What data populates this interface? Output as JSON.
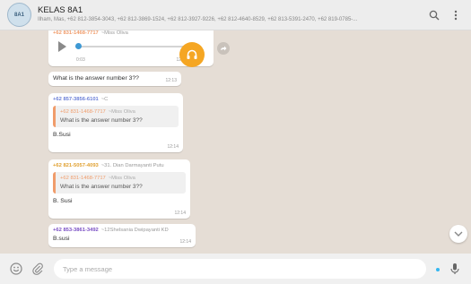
{
  "header": {
    "avatar_text": "8A1",
    "title": "KELAS 8A1",
    "subtitle": "Ilham, Mas, +62 812-3854-3043, +62 812-3869-1524, +62 812-3927-9226, +62 812-4640-8529, +62 813-5391-2470, +62 819-0785-..."
  },
  "messages": [
    {
      "type": "audio",
      "sender": "+62 831-1468-7717",
      "alias": "~Miss Oliva",
      "elapsed": "0:03",
      "time": "12:13"
    },
    {
      "type": "text",
      "text": "What is the answer number 3??",
      "time": "12:13"
    },
    {
      "type": "reply",
      "sender": "+62 857-3856-6101",
      "alias": "~C",
      "quote_sender": "+62 831-1468-7717",
      "quote_alias": "~Miss Oliva",
      "quote_text": "What is the answer number 3??",
      "text": "B.Susi",
      "time": "12:14"
    },
    {
      "type": "reply",
      "sender": "+62 821-5057-4093",
      "alias": "~31. Dian Darmayanti Putu",
      "quote_sender": "+62 831-1468-7717",
      "quote_alias": "~Miss Oliva",
      "quote_text": "What is the answer number 3??",
      "text": "B. Susi",
      "time": "12:14"
    },
    {
      "type": "text_sender",
      "sender": "+62 853-3861-3492",
      "alias": "~12Shelsania Dwipayanti KD",
      "text": "B.susi",
      "time": "12:14"
    }
  ],
  "composer": {
    "placeholder": "Type a message"
  },
  "colors": {
    "header_bg": "#ededed",
    "chat_bg": "#e5ddd5",
    "bubble_bg": "#ffffff",
    "audio_accent": "#f5a623",
    "sender_1": "#f09c6b",
    "sender_2": "#6b7fd7",
    "sender_3": "#e0a030",
    "sender_4": "#7a4fc4"
  },
  "icons": [
    "group-avatar-icon",
    "search-icon",
    "menu-icon",
    "play-icon",
    "headphones-icon",
    "forward-icon",
    "scroll-down-icon",
    "emoji-icon",
    "attach-icon",
    "mic-icon"
  ]
}
